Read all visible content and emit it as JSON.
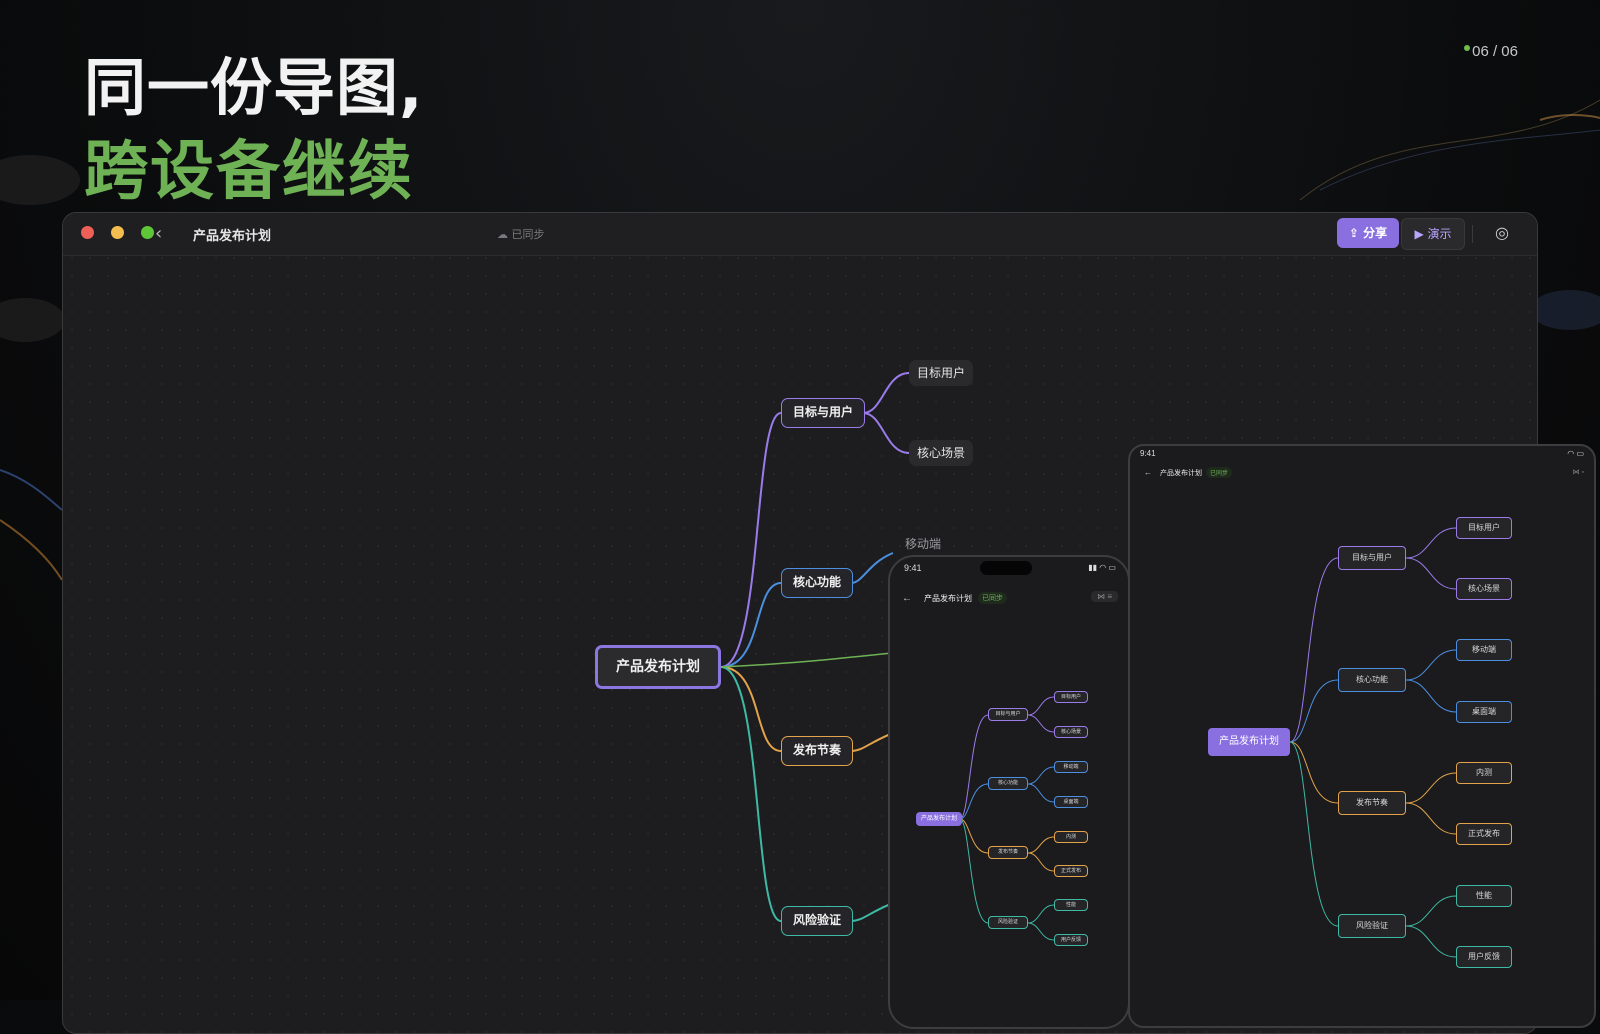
{
  "slide": {
    "headline_line1": "同一份导图,",
    "headline_line2": "跨设备继续",
    "pager": "06 / 06"
  },
  "window": {
    "back_glyph": "‹",
    "title": "产品发布计划",
    "sync_status": "已同步",
    "share_label": "分享",
    "present_label": "演示"
  },
  "mindmap": {
    "root": "产品发布计划",
    "branches": [
      {
        "label": "目标与用户",
        "color": "#9b7bea",
        "children": [
          "目标用户",
          "核心场景"
        ]
      },
      {
        "label": "核心功能",
        "color": "#4c8fe0",
        "children": [
          "移动端",
          "桌面端"
        ]
      },
      {
        "label": "发布节奏",
        "color": "#e2a34a",
        "children": [
          "内测",
          "正式发布"
        ]
      },
      {
        "label": "风险验证",
        "color": "#3fb9a5",
        "children": [
          "性能",
          "用户反馈"
        ]
      }
    ],
    "partial_visible_leaf": "移动端"
  },
  "phone": {
    "time": "9:41",
    "title": "产品发布计划",
    "badge": "已同步"
  },
  "tablet": {
    "time": "9:41",
    "title": "产品发布计划",
    "badge": "已同步"
  },
  "colors": {
    "accent": "#8a6fe0",
    "green": "#6fb255",
    "purple": "#9b7bea",
    "blue": "#4c8fe0",
    "orange": "#e2a34a",
    "teal": "#3fb9a5"
  },
  "icons": {
    "share": "share-icon",
    "present": "play-icon",
    "theme": "palette-icon",
    "cloud": "cloud-icon"
  }
}
